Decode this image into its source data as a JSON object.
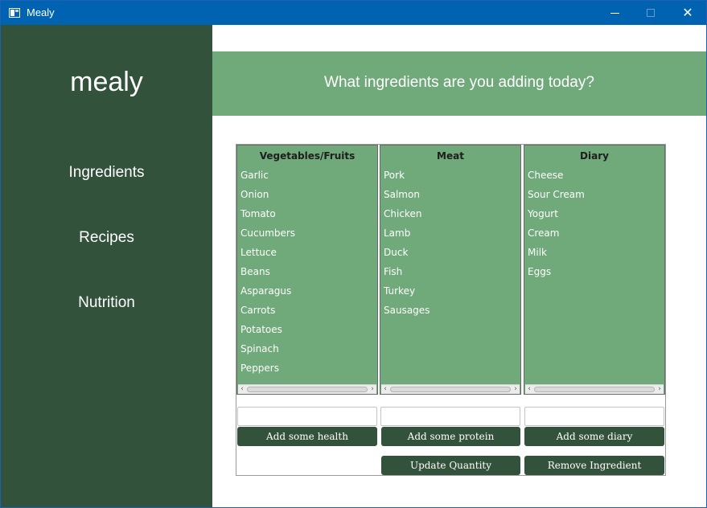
{
  "window": {
    "title": "Mealy",
    "close_glyph": "✕"
  },
  "sidebar": {
    "brand": "mealy",
    "items": [
      {
        "label": "Ingredients"
      },
      {
        "label": "Recipes"
      },
      {
        "label": "Nutrition"
      }
    ]
  },
  "header": {
    "title": "What ingredients are you adding today?"
  },
  "columns": [
    {
      "title": "Vegetables/Fruits",
      "items": [
        "Garlic",
        "Onion",
        "Tomato",
        "Cucumbers",
        "Lettuce",
        "Beans",
        "Asparagus",
        "Carrots",
        "Potatoes",
        "Spinach",
        "Peppers"
      ],
      "input_value": "",
      "add_label": "Add some health"
    },
    {
      "title": "Meat",
      "items": [
        "Pork",
        "Salmon",
        "Chicken",
        "Lamb",
        "Duck",
        "Fish",
        "Turkey",
        "Sausages"
      ],
      "input_value": "",
      "add_label": "Add some protein"
    },
    {
      "title": "Diary",
      "items": [
        "Cheese",
        "Sour Cream",
        "Yogurt",
        "Cream",
        "Milk",
        "Eggs"
      ],
      "input_value": "",
      "add_label": "Add some diary"
    }
  ],
  "actions": {
    "update_label": "Update Quantity",
    "remove_label": "Remove Ingredient"
  },
  "colors": {
    "sidebar": "#33523c",
    "accent_green": "#70a97a",
    "button": "#33523c",
    "titlebar": "#0063b1"
  },
  "icons": {
    "app": "app-window-icon",
    "minimize": "minimize-icon",
    "maximize": "maximize-icon",
    "close": "close-icon"
  }
}
